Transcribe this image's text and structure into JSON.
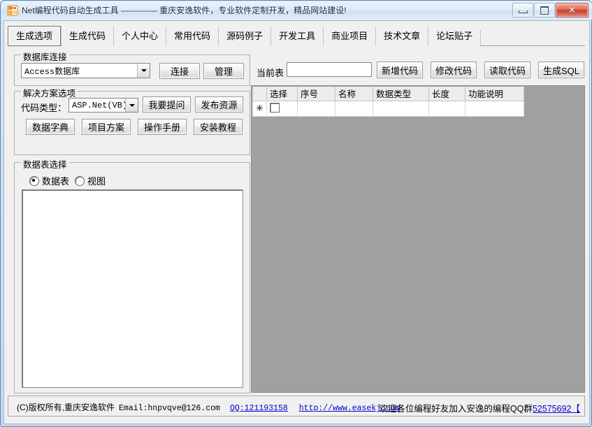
{
  "window": {
    "title": "Net编程代码自动生成工具 ------------- 重庆安逸软件，专业软件定制开发，精品网站建设!",
    "icon": "app-icon",
    "controls": {
      "minimize": "—",
      "maximize": "❐",
      "close": "✕"
    }
  },
  "tabs": [
    {
      "label": "生成选项",
      "active": true
    },
    {
      "label": "生成代码",
      "active": false
    },
    {
      "label": "个人中心",
      "active": false
    },
    {
      "label": "常用代码",
      "active": false
    },
    {
      "label": "源码例子",
      "active": false
    },
    {
      "label": "开发工具",
      "active": false
    },
    {
      "label": "商业项目",
      "active": false
    },
    {
      "label": "技术文章",
      "active": false
    },
    {
      "label": "论坛贴子",
      "active": false
    }
  ],
  "db_group": {
    "title": "数据库连接",
    "combo_value": "Access数据库",
    "connect_button": "连接",
    "manage_button": "管理"
  },
  "solution_group": {
    "title": "解决方案选项",
    "code_type_label": "代码类型：",
    "code_type_value": "ASP.Net(VB)",
    "ask_button": "我要提问",
    "publish_button": "发布资源",
    "dict_button": "数据字典",
    "project_button": "项目方案",
    "manual_button": "操作手册",
    "install_button": "安装教程"
  },
  "table_group": {
    "title": "数据表选择",
    "radio_table": "数据表",
    "radio_view": "视图",
    "radio_selected": "数据表",
    "list_items": []
  },
  "toolbar": {
    "current_table_label": "当前表",
    "current_table_value": "",
    "add_code_button": "新增代码",
    "modify_code_button": "修改代码",
    "read_code_button": "读取代码",
    "gen_sql_button": "生成SQL"
  },
  "grid": {
    "columns": [
      "选择",
      "序号",
      "名称",
      "数据类型",
      "长度",
      "功能说明"
    ],
    "new_row_marker": "✳",
    "rows": []
  },
  "status": {
    "copyright": "(C)版权所有,重庆安逸软件",
    "email": "Email:hnpvqve@126.com",
    "qq_link": "QQ:121193158",
    "url_link": "http://www.easekj.com",
    "right_text": "欢迎各位编程好友加入安逸的编程QQ群",
    "right_link": "52575692",
    "right_suffix": "【"
  },
  "colors": {
    "titlebar": "#d7e6f5",
    "client_bg": "#f0f0f0",
    "grid_panel_bg": "#a0a0a0",
    "link": "#0000cc",
    "close_button": "#c63d26"
  }
}
